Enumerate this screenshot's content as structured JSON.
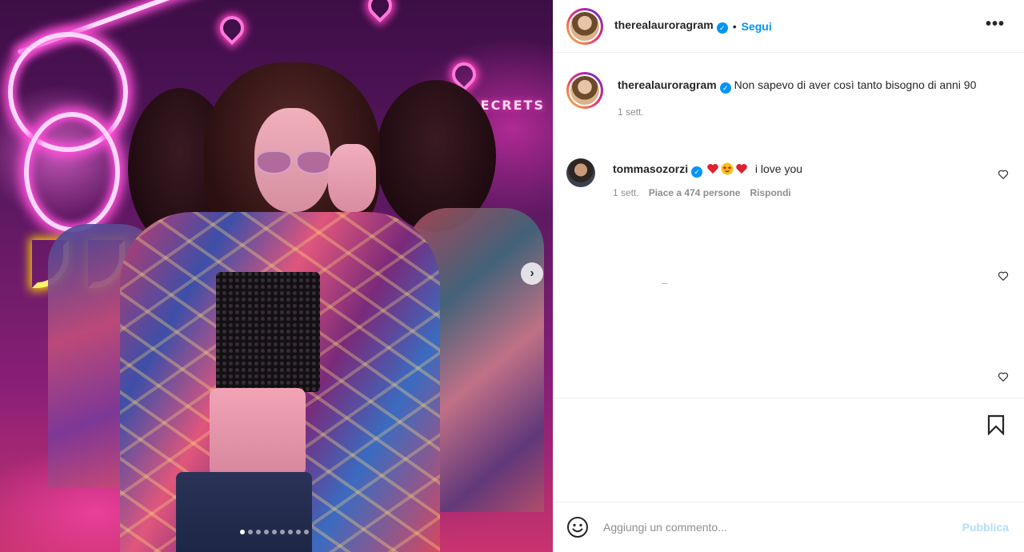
{
  "post": {
    "author": "therealauroragram",
    "follow_label": "Segui",
    "separator": "•",
    "more_label": "•••",
    "carousel": {
      "total": 9,
      "active": 0
    }
  },
  "caption": {
    "username": "therealauroragram",
    "text": "Non sapevo di aver così tanto bisogno di anni 90",
    "time": "1 sett."
  },
  "comments": [
    {
      "username": "tommasozorzi",
      "emojis": [
        "red-heart",
        "star-struck",
        "red-heart"
      ],
      "text": "i love you",
      "time": "1 sett.",
      "likes": "Piace a 474 persone",
      "reply": "Rispondi"
    }
  ],
  "photo_sign_text": "SECRETS",
  "comment_box": {
    "placeholder": "Aggiungi un commento...",
    "publish_label": "Pubblica"
  },
  "colors": {
    "accent": "#0095f6",
    "publish_disabled": "#b2dffc",
    "like_red": "#ed4956"
  },
  "icons": [
    "verified-badge-icon",
    "more-options-icon",
    "heart-icon",
    "bookmark-icon",
    "emoji-smile-icon",
    "chevron-right-icon"
  ]
}
